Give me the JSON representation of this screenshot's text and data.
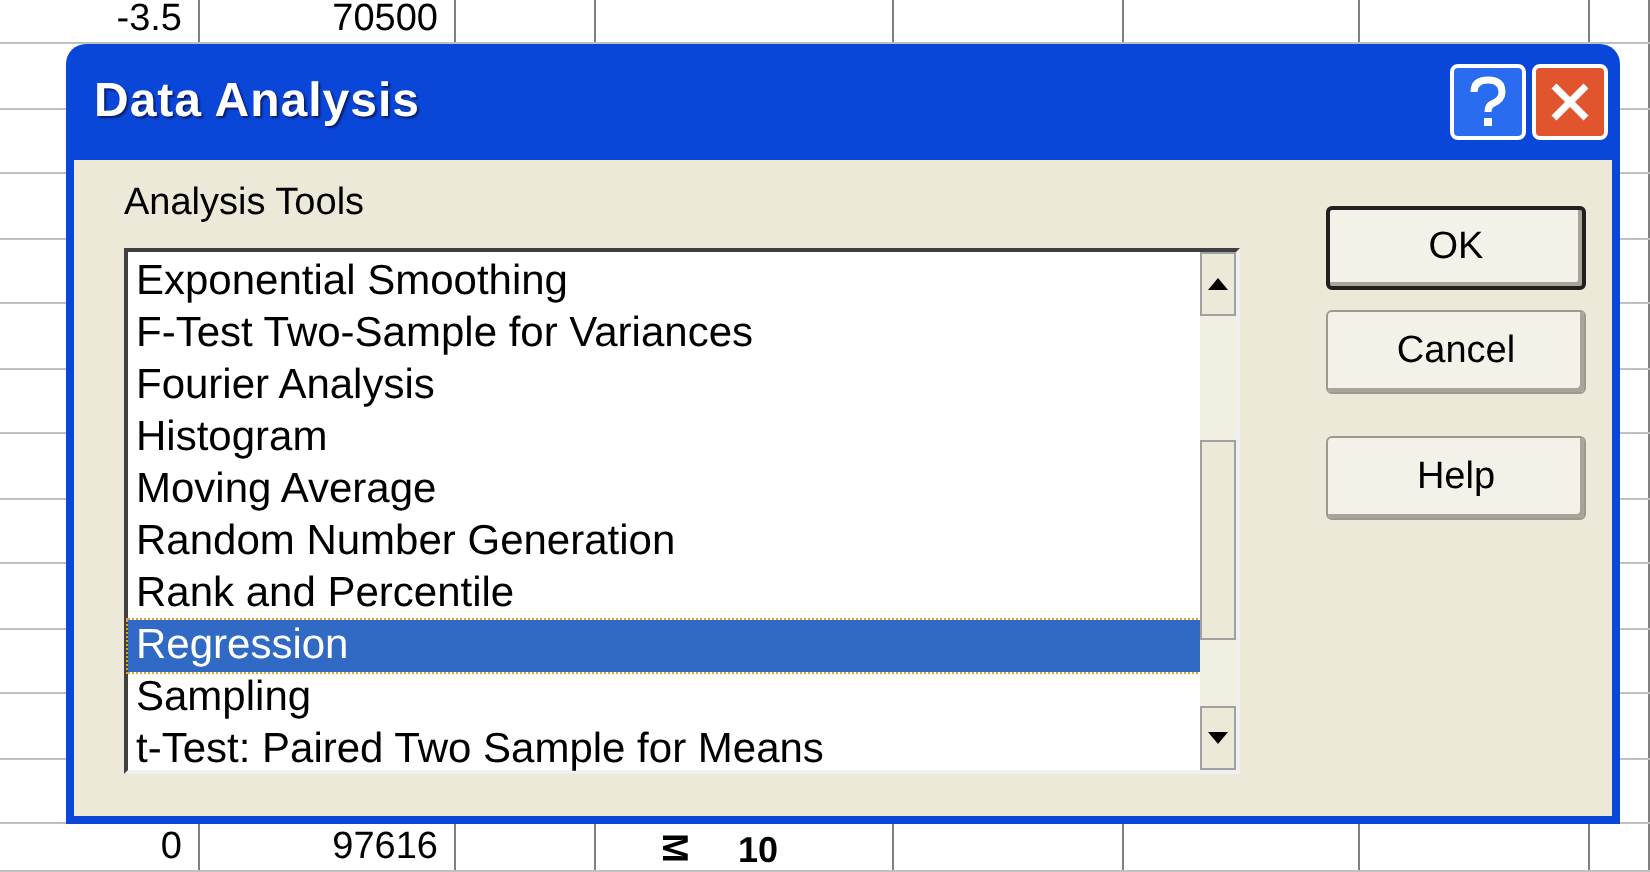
{
  "sheet": {
    "top_row": [
      "-3.5",
      "70500"
    ],
    "bottom_row": [
      "0",
      "97616",
      "M",
      "10"
    ]
  },
  "dialog": {
    "title": "Data Analysis",
    "list_label": "Analysis Tools",
    "items": [
      {
        "label": "Exponential Smoothing",
        "selected": false
      },
      {
        "label": "F-Test Two-Sample for Variances",
        "selected": false
      },
      {
        "label": "Fourier Analysis",
        "selected": false
      },
      {
        "label": "Histogram",
        "selected": false
      },
      {
        "label": "Moving Average",
        "selected": false
      },
      {
        "label": "Random Number Generation",
        "selected": false
      },
      {
        "label": "Rank and Percentile",
        "selected": false
      },
      {
        "label": "Regression",
        "selected": true
      },
      {
        "label": "Sampling",
        "selected": false
      },
      {
        "label": "t-Test: Paired Two Sample for Means",
        "selected": false
      }
    ],
    "buttons": [
      {
        "label": "OK",
        "default": true
      },
      {
        "label": "Cancel",
        "default": false
      },
      {
        "label": "Help",
        "default": false
      }
    ]
  }
}
